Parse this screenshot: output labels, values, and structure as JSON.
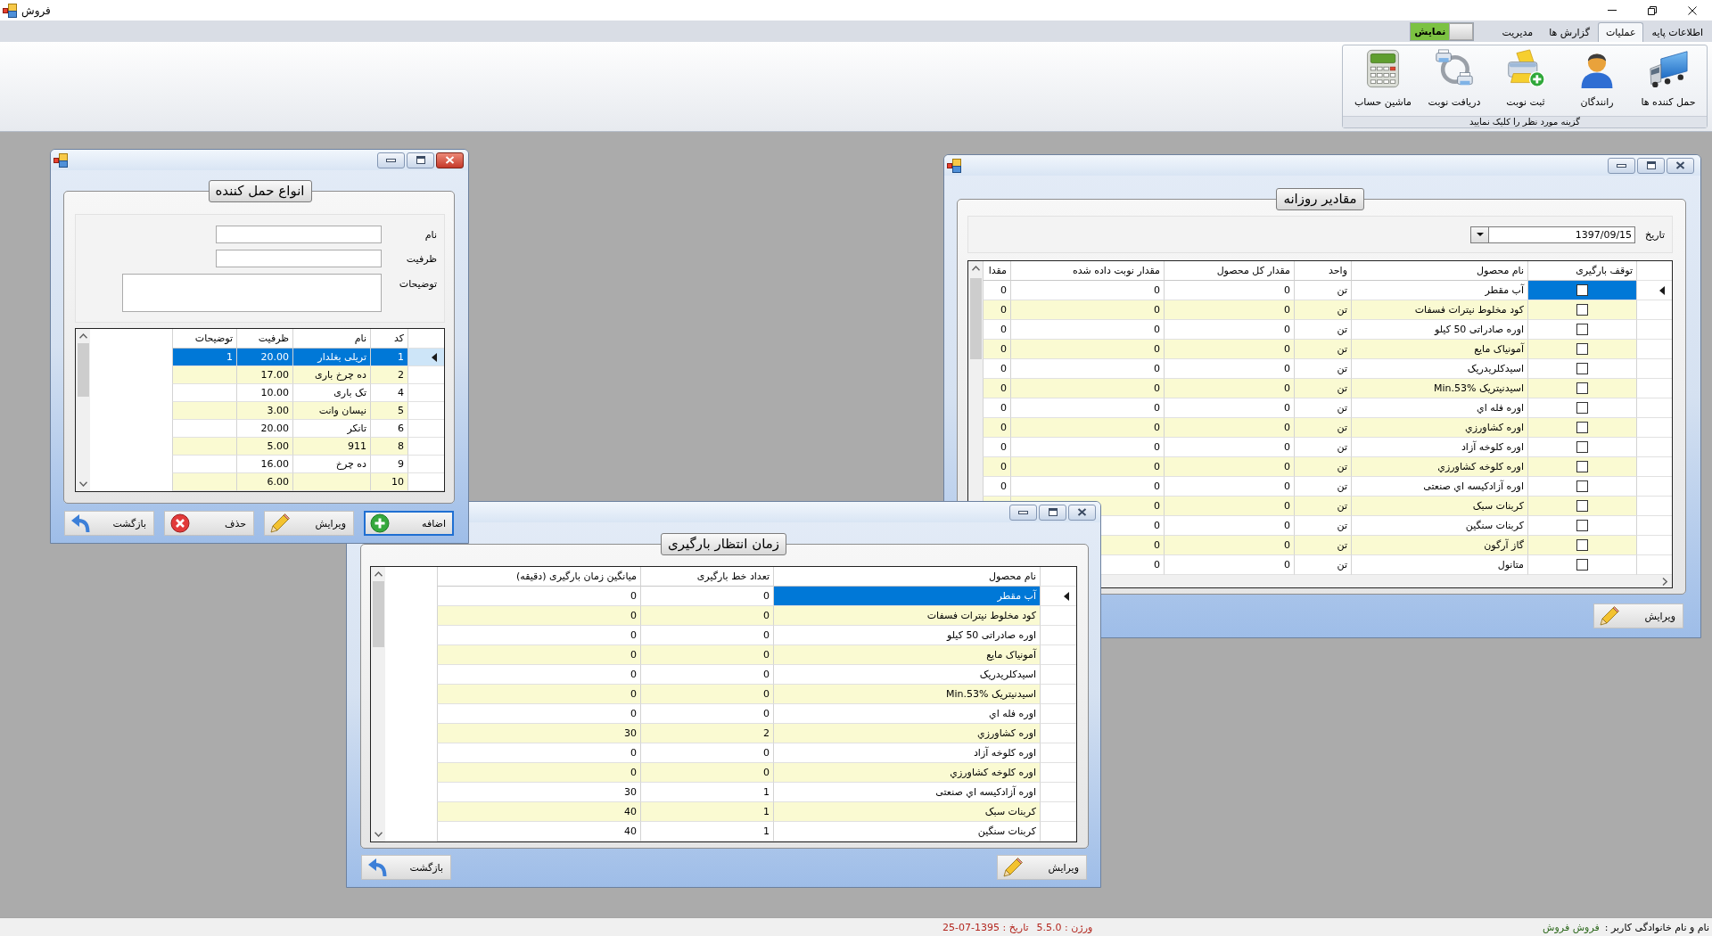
{
  "main_window": {
    "title": "فروش"
  },
  "ribbon": {
    "tabs": [
      {
        "label": "اطلاعات پایه",
        "selected": false
      },
      {
        "label": "عملیات",
        "selected": true
      },
      {
        "label": "گزارش ها",
        "selected": false
      },
      {
        "label": "مدیریت",
        "selected": false
      }
    ],
    "toggle": {
      "label": "نمایش",
      "on": true
    },
    "group": {
      "caption": "گزینه مورد نظر را کلیک نمایید",
      "items": [
        {
          "label": "حمل کننده ها",
          "kind": "carriers"
        },
        {
          "label": "رانندگان",
          "kind": "drivers"
        },
        {
          "label": "ثبت نوبت",
          "kind": "add_turn"
        },
        {
          "label": "دریافت نوبت",
          "kind": "receive_turn"
        },
        {
          "label": "ماشین حساب",
          "kind": "calculator"
        }
      ]
    }
  },
  "windows": [
    {
      "active": true,
      "heading": "انواع حمل کننده",
      "form": [
        {
          "label": "نام",
          "kind": "text"
        },
        {
          "label": "ظرفیت",
          "kind": "text"
        },
        {
          "label": "توضیحات",
          "kind": "textarea"
        }
      ],
      "grid": {
        "columns": [
          {
            "header": "کد",
            "kind": "text"
          },
          {
            "header": "نام",
            "kind": "text"
          },
          {
            "header": "ظرفیت",
            "kind": "text"
          },
          {
            "header": "توضیحات",
            "kind": "text"
          }
        ],
        "rows": [
          {
            "selected": true,
            "cells": [
              "1",
              "تریلی بغلدار",
              "20.00",
              "1"
            ]
          },
          {
            "selected": false,
            "cells": [
              "2",
              "ده چرخ باری",
              "17.00",
              ""
            ]
          },
          {
            "selected": false,
            "cells": [
              "4",
              "تک باری",
              "10.00",
              ""
            ]
          },
          {
            "selected": false,
            "cells": [
              "5",
              "نیسان وانت",
              "3.00",
              ""
            ]
          },
          {
            "selected": false,
            "cells": [
              "6",
              "تانکر",
              "20.00",
              ""
            ]
          },
          {
            "selected": false,
            "cells": [
              "8",
              "911",
              "5.00",
              ""
            ]
          },
          {
            "selected": false,
            "cells": [
              "9",
              "ده چرخ",
              "16.00",
              ""
            ]
          },
          {
            "selected": false,
            "cells": [
              "10",
              "",
              "6.00",
              ""
            ]
          }
        ]
      },
      "buttons": [
        {
          "label": "اضافه",
          "kind": "add",
          "focused": true
        },
        {
          "label": "ویرایش",
          "kind": "edit",
          "focused": false
        },
        {
          "label": "حذف",
          "kind": "delete",
          "focused": false
        },
        {
          "label": "بازگشت",
          "kind": "back",
          "focused": false
        }
      ]
    },
    {
      "active": false,
      "heading": "مقادیر روزانه",
      "date_filter": {
        "label": "تاریخ",
        "value": "1397/09/15"
      },
      "grid": {
        "columns": [
          {
            "header": "توقف بارگیری",
            "kind": "checkbox"
          },
          {
            "header": "نام محصول",
            "kind": "text"
          },
          {
            "header": "واحد",
            "kind": "text"
          },
          {
            "header": "مقدار کل محصول",
            "kind": "text"
          },
          {
            "header": "مقدار نوبت داده شده",
            "kind": "text"
          },
          {
            "header": "مقدا",
            "kind": "text"
          }
        ],
        "rows": [
          {
            "selected": true,
            "checked": false,
            "cells": [
              "",
              "آب مقطر",
              "تن",
              "0",
              "0",
              "0"
            ]
          },
          {
            "selected": false,
            "checked": false,
            "cells": [
              "",
              "کود مخلوط نیترات فسفات",
              "تن",
              "0",
              "0",
              "0"
            ]
          },
          {
            "selected": false,
            "checked": false,
            "cells": [
              "",
              "اوره صادراتی 50 کیلو",
              "تن",
              "0",
              "0",
              "0"
            ]
          },
          {
            "selected": false,
            "checked": false,
            "cells": [
              "",
              "آمونیاک مایع",
              "تن",
              "0",
              "0",
              "0"
            ]
          },
          {
            "selected": false,
            "checked": false,
            "cells": [
              "",
              "اسیدکلریدریک",
              "تن",
              "0",
              "0",
              "0"
            ]
          },
          {
            "selected": false,
            "checked": false,
            "cells": [
              "",
              "اسیدنیتریک Min.53%",
              "تن",
              "0",
              "0",
              "0"
            ]
          },
          {
            "selected": false,
            "checked": false,
            "cells": [
              "",
              "اوره فله اي",
              "تن",
              "0",
              "0",
              "0"
            ]
          },
          {
            "selected": false,
            "checked": false,
            "cells": [
              "",
              "اوره کشاورزي",
              "تن",
              "0",
              "0",
              "0"
            ]
          },
          {
            "selected": false,
            "checked": false,
            "cells": [
              "",
              "اوره کلوخه آزاد",
              "تن",
              "0",
              "0",
              "0"
            ]
          },
          {
            "selected": false,
            "checked": false,
            "cells": [
              "",
              "اوره کلوخه کشاورزي",
              "تن",
              "0",
              "0",
              "0"
            ]
          },
          {
            "selected": false,
            "checked": false,
            "cells": [
              "",
              "اوره آزادکیسه اي صنعتی",
              "تن",
              "0",
              "0",
              "0"
            ]
          },
          {
            "selected": false,
            "checked": false,
            "cells": [
              "",
              "کربنات سبک",
              "تن",
              "0",
              "0"
            ]
          },
          {
            "selected": false,
            "checked": false,
            "cells": [
              "",
              "کربنات سنگین",
              "تن",
              "0",
              "0"
            ]
          },
          {
            "selected": false,
            "checked": false,
            "cells": [
              "",
              "گاز آرگون",
              "تن",
              "0",
              "0"
            ]
          },
          {
            "selected": false,
            "checked": false,
            "cells": [
              "",
              "متانول",
              "تن",
              "0",
              "0"
            ]
          }
        ]
      },
      "buttons": [
        {
          "label": "ویرایش",
          "kind": "edit",
          "focused": false
        }
      ]
    },
    {
      "active": false,
      "heading": "زمان انتظار بارگیری",
      "grid": {
        "columns": [
          {
            "header": "نام محصول",
            "kind": "text"
          },
          {
            "header": "تعداد خط بارگیری",
            "kind": "text"
          },
          {
            "header": "میانگین زمان بارگیری (دقیقه)",
            "kind": "text"
          }
        ],
        "rows": [
          {
            "selected": true,
            "cells": [
              "آب مقطر",
              "0",
              "0"
            ]
          },
          {
            "selected": false,
            "cells": [
              "کود مخلوط نیترات فسفات",
              "0",
              "0"
            ]
          },
          {
            "selected": false,
            "cells": [
              "اوره صادراتی 50 کیلو",
              "0",
              "0"
            ]
          },
          {
            "selected": false,
            "cells": [
              "آمونیاک مایع",
              "0",
              "0"
            ]
          },
          {
            "selected": false,
            "cells": [
              "اسیدکلریدریک",
              "0",
              "0"
            ]
          },
          {
            "selected": false,
            "cells": [
              "اسیدنیتریک Min.53%",
              "0",
              "0"
            ]
          },
          {
            "selected": false,
            "cells": [
              "اوره فله اي",
              "0",
              "0"
            ]
          },
          {
            "selected": false,
            "cells": [
              "اوره کشاورزي",
              "2",
              "30"
            ]
          },
          {
            "selected": false,
            "cells": [
              "اوره کلوخه آزاد",
              "0",
              "0"
            ]
          },
          {
            "selected": false,
            "cells": [
              "اوره کلوخه کشاورزي",
              "0",
              "0"
            ]
          },
          {
            "selected": false,
            "cells": [
              "اوره آزادکیسه اي صنعتی",
              "1",
              "30"
            ]
          },
          {
            "selected": false,
            "cells": [
              "کربنات سبک",
              "1",
              "40"
            ]
          },
          {
            "selected": false,
            "cells": [
              "کربنات سنگین",
              "1",
              "40"
            ]
          }
        ]
      },
      "buttons": [
        {
          "label": "ویرایش",
          "kind": "edit",
          "focused": false
        },
        {
          "label": "بازگشت",
          "kind": "back",
          "focused": false
        }
      ]
    }
  ],
  "status_bar": {
    "user_label": "نام و نام خانوادگی کاربر :",
    "user_name": "فروش فروش",
    "version": "ورژن : 5.5.0",
    "date": "تاریخ : 1395-07-25"
  }
}
